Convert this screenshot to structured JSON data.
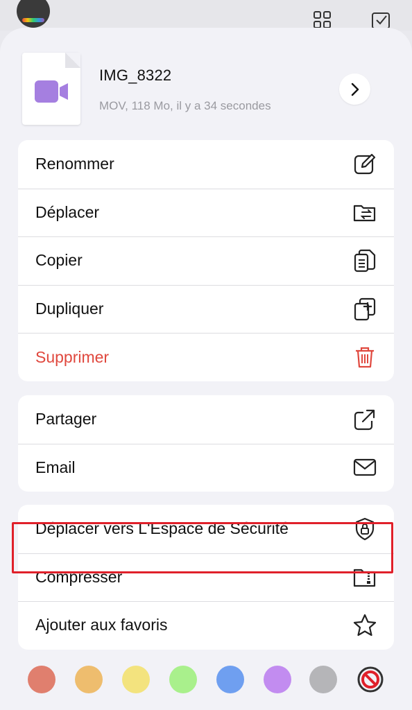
{
  "file": {
    "name": "IMG_8322",
    "meta": "MOV, 118 Mo, il y a 34 secondes"
  },
  "actions_group1": [
    {
      "label": "Renommer",
      "icon": "edit-icon"
    },
    {
      "label": "Déplacer",
      "icon": "folder-move-icon"
    },
    {
      "label": "Copier",
      "icon": "copy-icon"
    },
    {
      "label": "Dupliquer",
      "icon": "duplicate-icon"
    },
    {
      "label": "Supprimer",
      "icon": "trash-icon"
    }
  ],
  "actions_group2": [
    {
      "label": "Partager",
      "icon": "share-icon"
    },
    {
      "label": "Email",
      "icon": "envelope-icon"
    }
  ],
  "actions_group3": [
    {
      "label": "Déplacer vers L'Espace de Sécurité",
      "icon": "shield-lock-icon"
    },
    {
      "label": "Compresser",
      "icon": "zip-folder-icon"
    },
    {
      "label": "Ajouter aux favoris",
      "icon": "star-icon"
    }
  ],
  "colors": {
    "accent_danger": "#e0483e",
    "highlight": "#e0202a",
    "video_icon": "#a57fe0",
    "tags": [
      "#e07f6e",
      "#eebd6e",
      "#f3e37e",
      "#a9f08c",
      "#6f9ff0",
      "#c28cf0",
      "#b5b5b8"
    ]
  }
}
